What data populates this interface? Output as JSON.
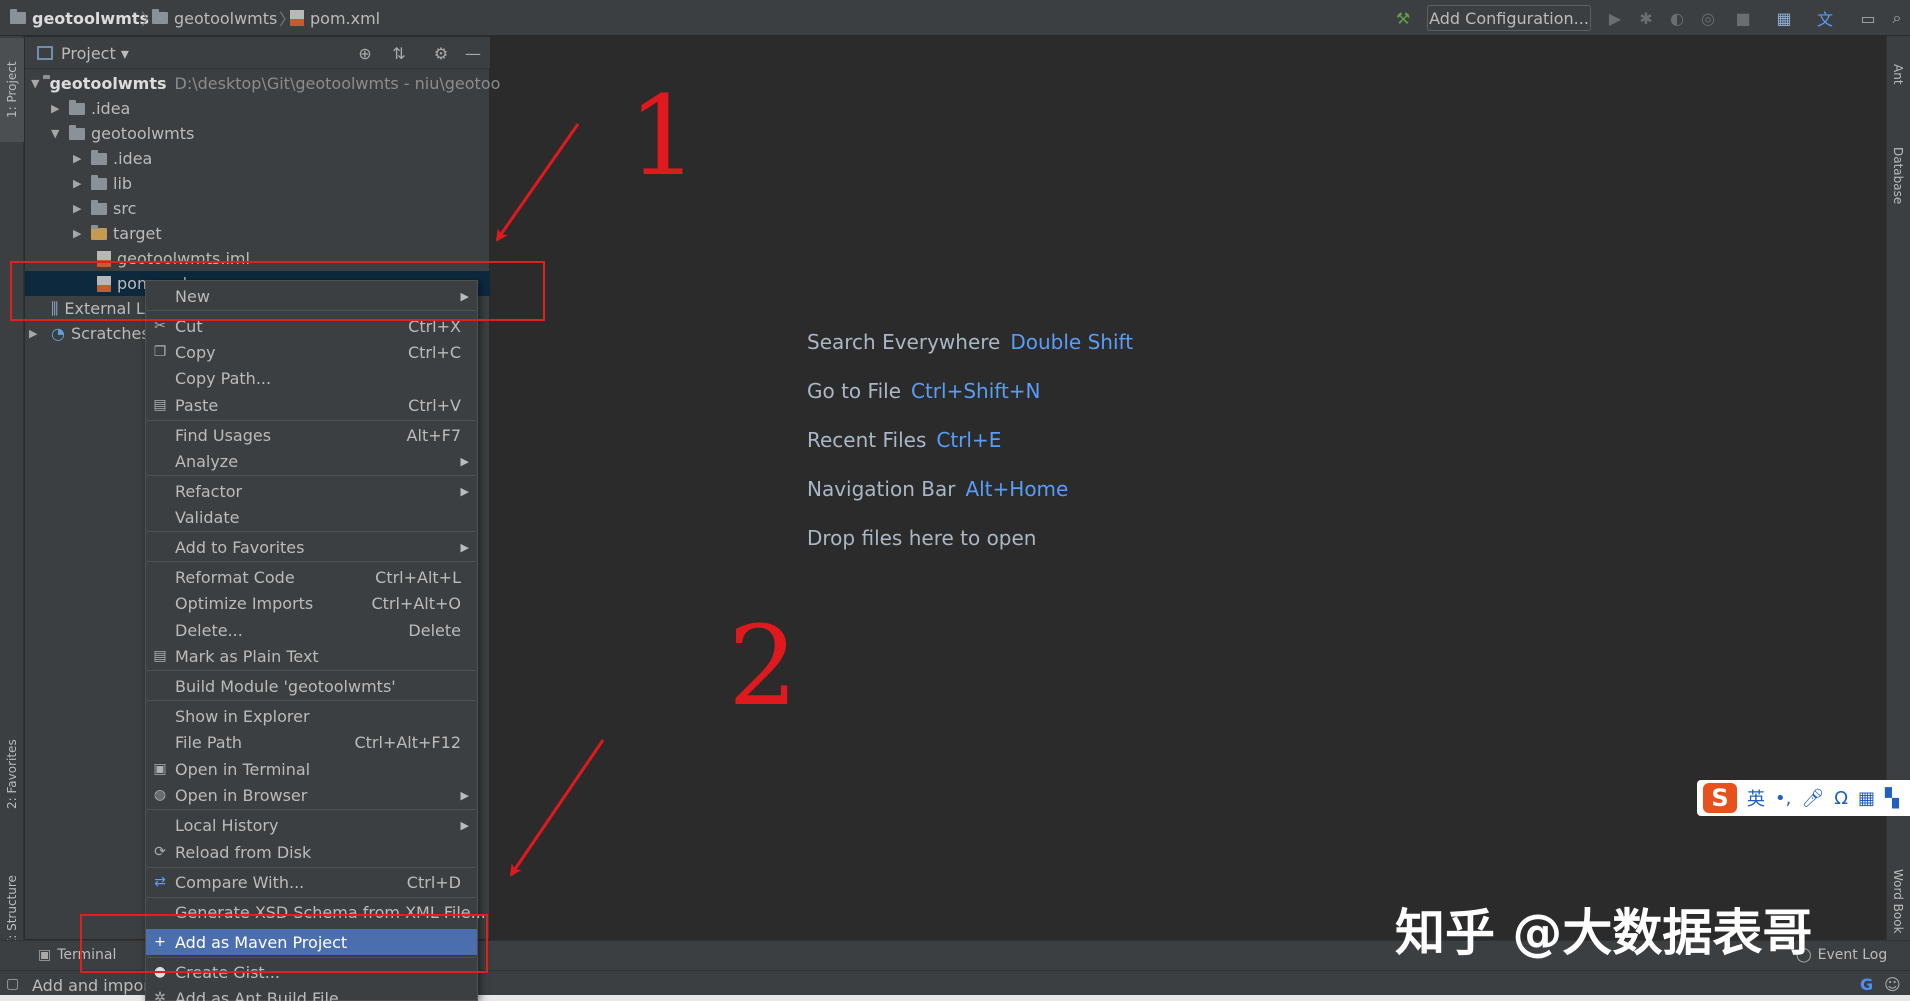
{
  "breadcrumb": {
    "root": "geotoolwmts",
    "folder": "geotoolwmts",
    "file": "pom.xml"
  },
  "toolbar": {
    "add_configuration": "Add Configuration..."
  },
  "left_tabs": {
    "project": "1: Project",
    "favorites": "2: Favorites",
    "structure": "Z: Structure"
  },
  "right_tabs": {
    "ant": "Ant",
    "database": "Database",
    "word_book": "Word Book"
  },
  "project_panel": {
    "title": "Project",
    "tree": [
      {
        "label": "geotoolwmts",
        "path": "D:\\desktop\\Git\\geotoolwmts - niu\\geotoo"
      },
      {
        "label": ".idea"
      },
      {
        "label": "geotoolwmts"
      },
      {
        "label": ".idea"
      },
      {
        "label": "lib"
      },
      {
        "label": "src"
      },
      {
        "label": "target"
      },
      {
        "label": "geotoolwmts.iml"
      },
      {
        "label": "pom.xml"
      },
      {
        "label": "External Libraries"
      },
      {
        "label": "Scratches and Consoles"
      }
    ]
  },
  "welcome": {
    "hints": [
      {
        "label": "Search Everywhere",
        "key": "Double Shift"
      },
      {
        "label": "Go to File",
        "key": "Ctrl+Shift+N"
      },
      {
        "label": "Recent Files",
        "key": "Ctrl+E"
      },
      {
        "label": "Navigation Bar",
        "key": "Alt+Home"
      },
      {
        "label": "Drop files here to open",
        "key": ""
      }
    ]
  },
  "context_menu": {
    "items": [
      {
        "label": "New",
        "shortcut": "",
        "sub": true
      },
      {
        "label": "Cut",
        "shortcut": "Ctrl+X",
        "icon": "scissors-icon"
      },
      {
        "label": "Copy",
        "shortcut": "Ctrl+C",
        "icon": "copy-icon"
      },
      {
        "label": "Copy Path...",
        "shortcut": ""
      },
      {
        "label": "Paste",
        "shortcut": "Ctrl+V",
        "icon": "clipboard-icon"
      },
      {
        "label": "Find Usages",
        "shortcut": "Alt+F7"
      },
      {
        "label": "Analyze",
        "shortcut": "",
        "sub": true
      },
      {
        "label": "Refactor",
        "shortcut": "",
        "sub": true
      },
      {
        "label": "Validate",
        "shortcut": ""
      },
      {
        "label": "Add to Favorites",
        "shortcut": "",
        "sub": true
      },
      {
        "label": "Reformat Code",
        "shortcut": "Ctrl+Alt+L"
      },
      {
        "label": "Optimize Imports",
        "shortcut": "Ctrl+Alt+O"
      },
      {
        "label": "Delete...",
        "shortcut": "Delete"
      },
      {
        "label": "Mark as Plain Text",
        "shortcut": "",
        "icon": "text-file-icon"
      },
      {
        "label": "Build Module 'geotoolwmts'",
        "shortcut": ""
      },
      {
        "label": "Show in Explorer",
        "shortcut": ""
      },
      {
        "label": "File Path",
        "shortcut": "Ctrl+Alt+F12"
      },
      {
        "label": "Open in Terminal",
        "shortcut": "",
        "icon": "terminal-icon"
      },
      {
        "label": "Open in Browser",
        "shortcut": "",
        "sub": true,
        "icon": "globe-icon"
      },
      {
        "label": "Local History",
        "shortcut": "",
        "sub": true
      },
      {
        "label": "Reload from Disk",
        "shortcut": "",
        "icon": "reload-icon"
      },
      {
        "label": "Compare With...",
        "shortcut": "Ctrl+D",
        "icon": "compare-icon"
      },
      {
        "label": "Generate XSD Schema from XML File...",
        "shortcut": ""
      },
      {
        "label": "Add as Maven Project",
        "shortcut": "",
        "icon": "plus-icon"
      },
      {
        "label": "Create Gist...",
        "shortcut": "",
        "icon": "github-icon"
      },
      {
        "label": "Add as Ant Build File",
        "shortcut": "",
        "icon": "ant-icon"
      }
    ]
  },
  "bottom": {
    "terminal": "Terminal",
    "status_text": "Add and import",
    "event_log": "Event Log"
  },
  "annotations": {
    "number_1": "1",
    "number_2": "2",
    "watermark": "知乎 @大数据表哥"
  },
  "ime": {
    "logo": "S",
    "lang": "英"
  },
  "colors": {
    "background": "#2b2b2b",
    "panel": "#3c3f41",
    "accent": "#589df6",
    "menu_highlight": "#4b6eaf",
    "annotation_red": "#e02020"
  }
}
